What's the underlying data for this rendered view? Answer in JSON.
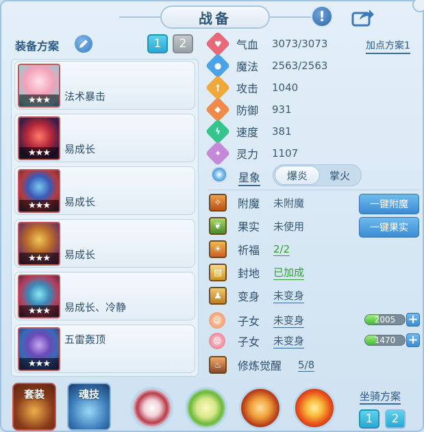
{
  "title": "战备",
  "left": {
    "scheme_label": "装备方案",
    "scheme_buttons": [
      "1",
      "2"
    ],
    "items": [
      {
        "name": "法术暴击",
        "stars": "★★★",
        "icon": "popsicle-weapon-icon"
      },
      {
        "name": "易成长",
        "stars": "★★★",
        "icon": "red-fan-icon"
      },
      {
        "name": "易成长",
        "stars": "★★★",
        "icon": "mask-armor-icon"
      },
      {
        "name": "易成长",
        "stars": "★★★",
        "icon": "necklace-icon"
      },
      {
        "name": "易成长、冷静",
        "stars": "★★★",
        "icon": "belt-icon"
      },
      {
        "name": "五雷轰顶",
        "stars": "★★★",
        "icon": "robe-icon"
      }
    ]
  },
  "stats": {
    "plan_link": "加点方案1",
    "rows": [
      {
        "label": "气血",
        "value": "3073/3073",
        "color": "#e8697a",
        "icon": "heart-icon"
      },
      {
        "label": "魔法",
        "value": "2563/2563",
        "color": "#4aa3e8",
        "icon": "mana-icon"
      },
      {
        "label": "攻击",
        "value": "1040",
        "color": "#f0a83a",
        "icon": "sword-icon"
      },
      {
        "label": "防御",
        "value": "931",
        "color": "#ef8a4a",
        "icon": "shield-icon"
      },
      {
        "label": "速度",
        "value": "381",
        "color": "#35c48a",
        "icon": "lightning-icon"
      },
      {
        "label": "灵力",
        "value": "1107",
        "color": "#c48ad8",
        "icon": "spirit-icon"
      }
    ]
  },
  "star_sign": {
    "label": "星象",
    "options": [
      "爆炎",
      "掌火"
    ]
  },
  "features": [
    {
      "label": "附魔",
      "value": "未附魔",
      "style": "plain",
      "icon": "enchant-icon",
      "color": "#d66a2a"
    },
    {
      "label": "果实",
      "value": "未使用",
      "style": "plain",
      "icon": "fruit-icon",
      "color": "#6fae3a"
    },
    {
      "label": "祈福",
      "value": "2/2",
      "style": "green",
      "icon": "blessing-icon",
      "color": "#e07a2a"
    },
    {
      "label": "封地",
      "value": "已加成",
      "style": "green",
      "icon": "territory-icon",
      "color": "#e0b84a"
    },
    {
      "label": "变身",
      "value": "未变身",
      "style": "uline",
      "icon": "transform-icon",
      "color": "#d8a23a"
    }
  ],
  "side_buttons": [
    "一键附魔",
    "一键果实"
  ],
  "children": [
    {
      "label": "子女",
      "value": "未变身",
      "bar_value": "2005",
      "fill": 0.35,
      "color": "#ef8a5a",
      "icon": "child-boy-icon"
    },
    {
      "label": "子女",
      "value": "未变身",
      "bar_value": "1470",
      "fill": 0.28,
      "color": "#e8697a",
      "icon": "child-girl-icon"
    }
  ],
  "cultivation": {
    "label": "修炼觉醒",
    "value": "5/8"
  },
  "bottom": {
    "tabs": [
      "套装",
      "魂技"
    ],
    "mount_label": "坐骑方案",
    "mount_buttons": [
      "1",
      "2"
    ]
  }
}
